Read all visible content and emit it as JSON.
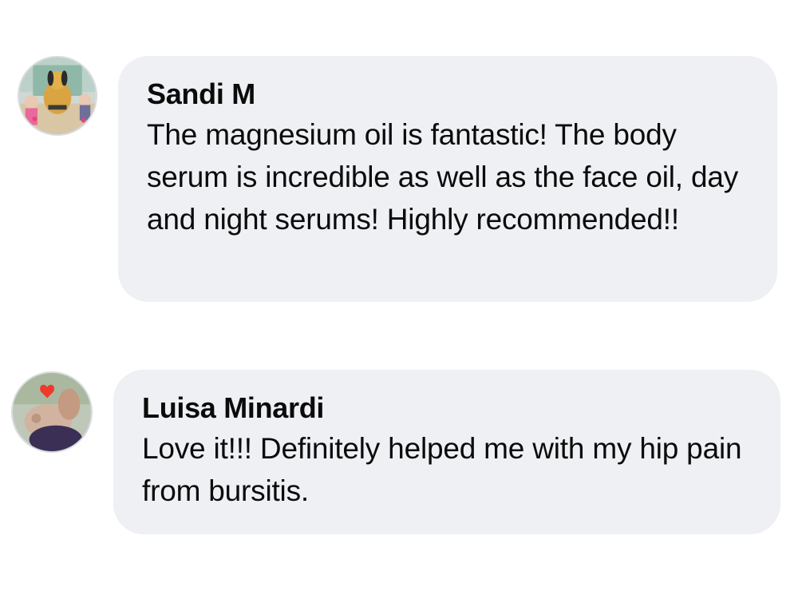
{
  "comments": [
    {
      "author": "Sandi M",
      "text": "The magnesium oil is fantastic! The body serum is incredible as well as the face oil, day and night serums! Highly recommended!!"
    },
    {
      "author": "Luisa Minardi",
      "text": "Love it!!! Definitely helped me with my hip pain from bursitis."
    }
  ],
  "colors": {
    "bubble_background": "#eff0f4",
    "text": "#0b0b0b",
    "avatar_border": "#d7dbe0"
  },
  "icons": [
    "avatar-photo",
    "avatar-photo"
  ]
}
